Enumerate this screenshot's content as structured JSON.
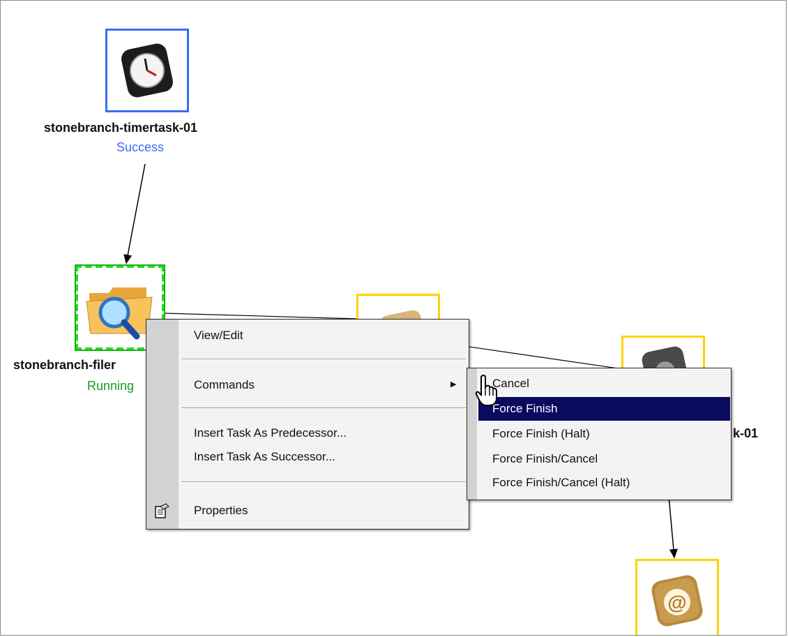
{
  "workflow": {
    "nodes": [
      {
        "name": "stonebranch-timertask-01",
        "status": "Success",
        "status_color": "#3a6cf4",
        "icon": "clock-icon"
      },
      {
        "name": "stonebranch-filer",
        "status": "Running",
        "status_color": "#1c9a1c",
        "icon": "folder-search-icon"
      },
      {
        "name": "k-01",
        "icon": "task-icon"
      },
      {
        "icon": "email-icon",
        "glyph": "@"
      }
    ]
  },
  "context_menu": {
    "items": {
      "view_edit": "View/Edit",
      "commands": "Commands",
      "insert_predecessor": "Insert Task As Predecessor...",
      "insert_successor": "Insert Task As Successor...",
      "properties": "Properties"
    },
    "submenu_arrow": "▶",
    "properties_icon": "properties-icon"
  },
  "commands_submenu": {
    "items": [
      "Cancel",
      "Force Finish",
      "Force Finish (Halt)",
      "Force Finish/Cancel",
      "Force Finish/Cancel (Halt)"
    ],
    "highlighted": "Force Finish",
    "highlight_color": "#0a0a60"
  },
  "cursor": "hand-pointer-icon"
}
